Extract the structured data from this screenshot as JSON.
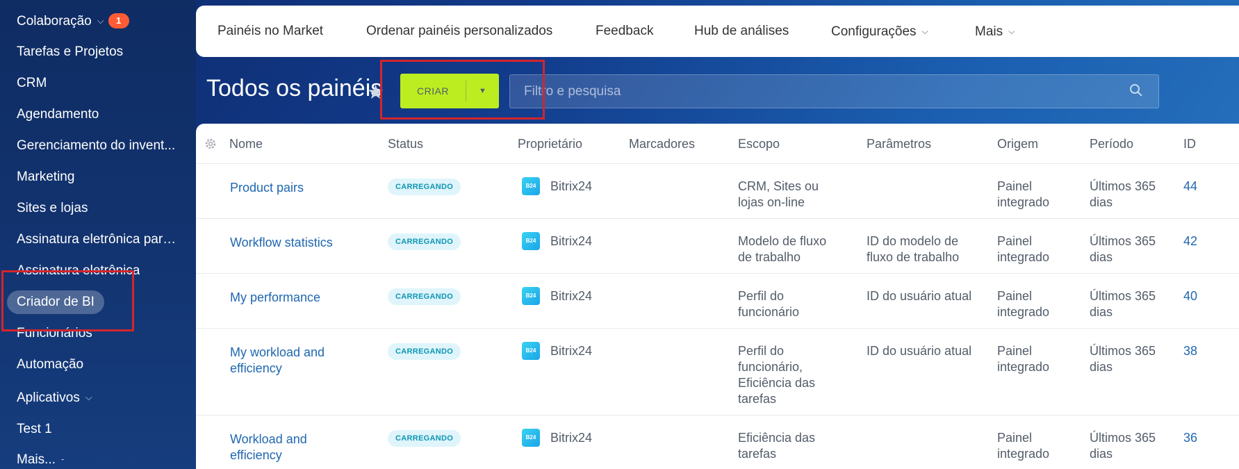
{
  "sidebar": {
    "items": [
      {
        "label": "Colaboração",
        "badge": "1"
      },
      {
        "label": "Tarefas e Projetos"
      },
      {
        "label": "CRM"
      },
      {
        "label": "Agendamento"
      },
      {
        "label": "Gerenciamento do invent..."
      },
      {
        "label": "Marketing"
      },
      {
        "label": "Sites e lojas"
      },
      {
        "label": "Assinatura eletrônica para..."
      },
      {
        "label": "Assinatura eletrônica"
      },
      {
        "label": "Criador de BI"
      },
      {
        "label": "Funcionários"
      },
      {
        "label": "Automação"
      },
      {
        "label": "Aplicativos"
      },
      {
        "label": "Test 1"
      },
      {
        "label": "Mais..."
      }
    ]
  },
  "topbar": {
    "tabs": [
      "Painéis no Market",
      "Ordenar painéis personalizados",
      "Feedback",
      "Hub de análises",
      "Configurações",
      "Mais"
    ]
  },
  "page": {
    "title": "Todos os painéis",
    "create_label": "CRIAR",
    "search_placeholder": "Filtro e pesquisa"
  },
  "table": {
    "columns": [
      "Nome",
      "Status",
      "Proprietário",
      "Marcadores",
      "Escopo",
      "Parâmetros",
      "Origem",
      "Período",
      "ID"
    ],
    "owner_logo_text": "B24",
    "rows": [
      {
        "name": "Product pairs",
        "status": "CARREGANDO",
        "owner": "Bitrix24",
        "tags": "",
        "scope": "CRM, Sites ou lojas on-line",
        "params": "",
        "origin": "Painel integrado",
        "period": "Últimos 365 dias",
        "id": "44"
      },
      {
        "name": "Workflow statistics",
        "status": "CARREGANDO",
        "owner": "Bitrix24",
        "tags": "",
        "scope": "Modelo de fluxo de trabalho",
        "params": "ID do modelo de fluxo de trabalho",
        "origin": "Painel integrado",
        "period": "Últimos 365 dias",
        "id": "42"
      },
      {
        "name": "My performance",
        "status": "CARREGANDO",
        "owner": "Bitrix24",
        "tags": "",
        "scope": "Perfil do funcionário",
        "params": "ID do usuário atual",
        "origin": "Painel integrado",
        "period": "Últimos 365 dias",
        "id": "40"
      },
      {
        "name": "My workload and efficiency",
        "status": "CARREGANDO",
        "owner": "Bitrix24",
        "tags": "",
        "scope": "Perfil do funcionário, Eficiência das tarefas",
        "params": "ID do usuário atual",
        "origin": "Painel integrado",
        "period": "Últimos 365 dias",
        "id": "38"
      },
      {
        "name": "Workload and efficiency",
        "status": "CARREGANDO",
        "owner": "Bitrix24",
        "tags": "",
        "scope": "Eficiência das tarefas",
        "params": "",
        "origin": "Painel integrado",
        "period": "Últimos 365 dias",
        "id": "36"
      }
    ]
  }
}
